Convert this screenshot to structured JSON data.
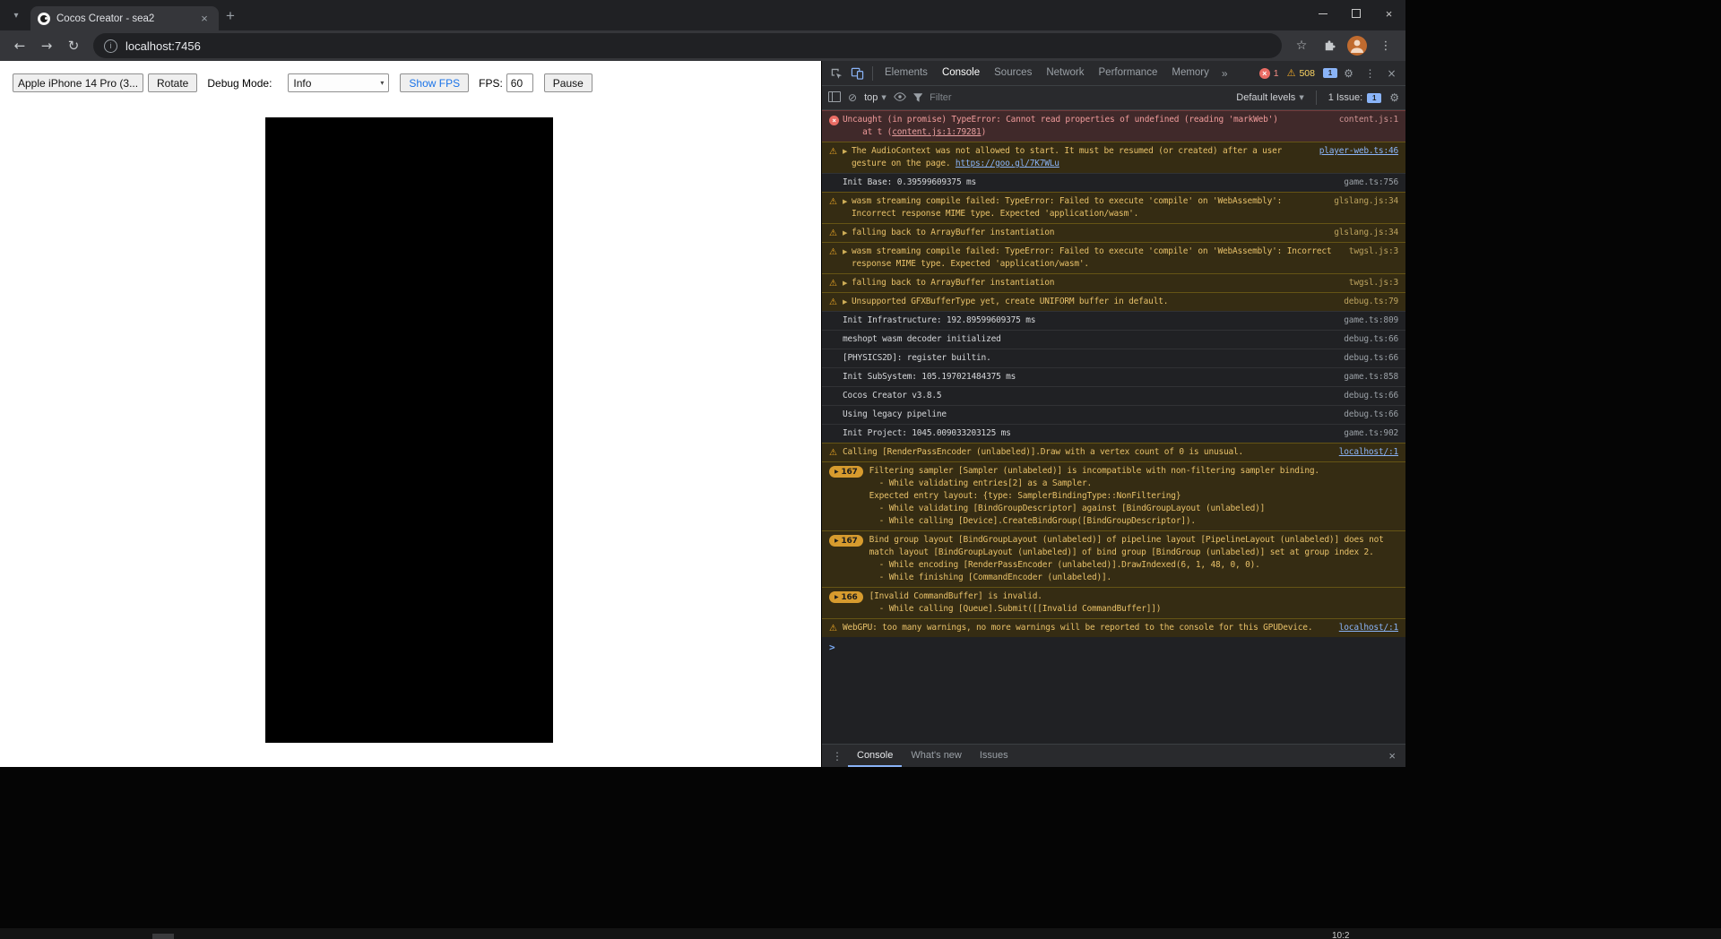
{
  "browser": {
    "tab_title": "Cocos Creator - sea2",
    "url": "localhost:7456"
  },
  "page": {
    "device_select": "Apple iPhone 14 Pro (3...",
    "rotate_label": "Rotate",
    "debug_mode_label": "Debug Mode:",
    "debug_mode_value": "Info",
    "show_fps_label": "Show FPS",
    "fps_label": "FPS:",
    "fps_value": "60",
    "pause_label": "Pause"
  },
  "devtools": {
    "tabs": [
      "Elements",
      "Console",
      "Sources",
      "Network",
      "Performance",
      "Memory"
    ],
    "selected_tab": "Console",
    "counts": {
      "errors": "1",
      "warnings": "508",
      "issues": "1"
    },
    "console_toolbar": {
      "context": "top",
      "filter_placeholder": "Filter",
      "levels": "Default levels",
      "issue_text": "1 Issue:",
      "issue_count": "1"
    },
    "messages": [
      {
        "type": "error",
        "source": "content.js:1",
        "source_style": "error",
        "segments": [
          {
            "text": "Uncaught (in promise) TypeError: Cannot read properties of undefined (reading 'markWeb')\n    at t ("
          },
          {
            "text": "content.js:1:79281",
            "link": true
          },
          {
            "text": ")"
          }
        ]
      },
      {
        "type": "warning",
        "expand": true,
        "source": "player-web.ts:46",
        "source_style": "link",
        "segments": [
          {
            "text": "The AudioContext was not allowed to start. It must be resumed (or created) after a user\ngesture on the page. "
          },
          {
            "text": "https://goo.gl/7K7WLu",
            "link": true
          }
        ]
      },
      {
        "type": "log",
        "source": "game.ts:756",
        "source_style": "muted",
        "segments": [
          {
            "text": "Init Base: 0.39599609375 ms"
          }
        ]
      },
      {
        "type": "warning",
        "expand": true,
        "source": "glslang.js:34",
        "source_style": "warn",
        "segments": [
          {
            "text": "wasm streaming compile failed: TypeError: Failed to execute 'compile' on 'WebAssembly':\nIncorrect response MIME type. Expected 'application/wasm'."
          }
        ]
      },
      {
        "type": "warning",
        "expand": true,
        "source": "glslang.js:34",
        "source_style": "warn",
        "segments": [
          {
            "text": "falling back to ArrayBuffer instantiation"
          }
        ]
      },
      {
        "type": "warning",
        "expand": true,
        "source": "twgsl.js:3",
        "source_style": "warn",
        "segments": [
          {
            "text": "wasm streaming compile failed: TypeError: Failed to execute 'compile' on 'WebAssembly': Incorrect\nresponse MIME type. Expected 'application/wasm'."
          }
        ]
      },
      {
        "type": "warning",
        "expand": true,
        "source": "twgsl.js:3",
        "source_style": "warn",
        "segments": [
          {
            "text": "falling back to ArrayBuffer instantiation"
          }
        ]
      },
      {
        "type": "warning",
        "expand": true,
        "source": "debug.ts:79",
        "source_style": "warn",
        "segments": [
          {
            "text": "Unsupported GFXBufferType yet, create UNIFORM buffer in default."
          }
        ]
      },
      {
        "type": "log",
        "source": "game.ts:809",
        "source_style": "muted",
        "segments": [
          {
            "text": "Init Infrastructure: 192.89599609375 ms"
          }
        ]
      },
      {
        "type": "log",
        "source": "debug.ts:66",
        "source_style": "muted",
        "segments": [
          {
            "text": "meshopt wasm decoder initialized"
          }
        ]
      },
      {
        "type": "log",
        "source": "debug.ts:66",
        "source_style": "muted",
        "segments": [
          {
            "text": "[PHYSICS2D]: register builtin."
          }
        ]
      },
      {
        "type": "log",
        "source": "game.ts:858",
        "source_style": "muted",
        "segments": [
          {
            "text": "Init SubSystem: 105.197021484375 ms"
          }
        ]
      },
      {
        "type": "log",
        "source": "debug.ts:66",
        "source_style": "muted",
        "segments": [
          {
            "text": "Cocos Creator v3.8.5"
          }
        ]
      },
      {
        "type": "log",
        "source": "debug.ts:66",
        "source_style": "muted",
        "segments": [
          {
            "text": "Using legacy pipeline"
          }
        ]
      },
      {
        "type": "log",
        "source": "game.ts:902",
        "source_style": "muted",
        "segments": [
          {
            "text": "Init Project: 1045.009033203125 ms"
          }
        ]
      },
      {
        "type": "warning",
        "source": "localhost/:1",
        "source_style": "link",
        "segments": [
          {
            "text": "Calling [RenderPassEncoder (unlabeled)].Draw with a vertex count of 0 is unusual."
          }
        ]
      },
      {
        "type": "warning",
        "badge": "167",
        "segments": [
          {
            "text": "Filtering sampler [Sampler (unlabeled)] is incompatible with non-filtering sampler binding.\n  - While validating entries[2] as a Sampler.\nExpected entry layout: {type: SamplerBindingType::NonFiltering}\n  - While validating [BindGroupDescriptor] against [BindGroupLayout (unlabeled)]\n  - While calling [Device].CreateBindGroup([BindGroupDescriptor])."
          }
        ]
      },
      {
        "type": "warning",
        "badge": "167",
        "segments": [
          {
            "text": "Bind group layout [BindGroupLayout (unlabeled)] of pipeline layout [PipelineLayout (unlabeled)] does not\nmatch layout [BindGroupLayout (unlabeled)] of bind group [BindGroup (unlabeled)] set at group index 2.\n  - While encoding [RenderPassEncoder (unlabeled)].DrawIndexed(6, 1, 48, 0, 0).\n  - While finishing [CommandEncoder (unlabeled)]."
          }
        ]
      },
      {
        "type": "warning",
        "badge": "166",
        "segments": [
          {
            "text": "[Invalid CommandBuffer] is invalid.\n  - While calling [Queue].Submit([[Invalid CommandBuffer]])"
          }
        ]
      },
      {
        "type": "warning",
        "source": "localhost/:1",
        "source_style": "link",
        "segments": [
          {
            "text": "WebGPU: too many warnings, no more warnings will be reported to the console for this GPUDevice."
          }
        ]
      }
    ],
    "drawer": {
      "items": [
        "Console",
        "What's new",
        "Issues"
      ],
      "selected": "Console"
    }
  },
  "taskbar": {
    "clock": "10:2"
  }
}
